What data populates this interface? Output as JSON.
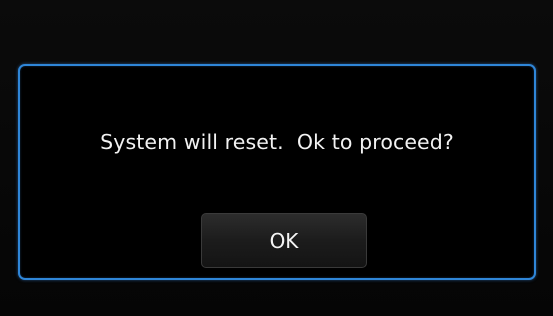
{
  "dialog": {
    "message": "System will reset.  Ok to proceed?",
    "ok_label": "OK"
  },
  "colors": {
    "background": "#000000",
    "dialog_border": "#2f86d8",
    "text": "#f2f2f2",
    "button_bg": "#1c1c1c"
  }
}
